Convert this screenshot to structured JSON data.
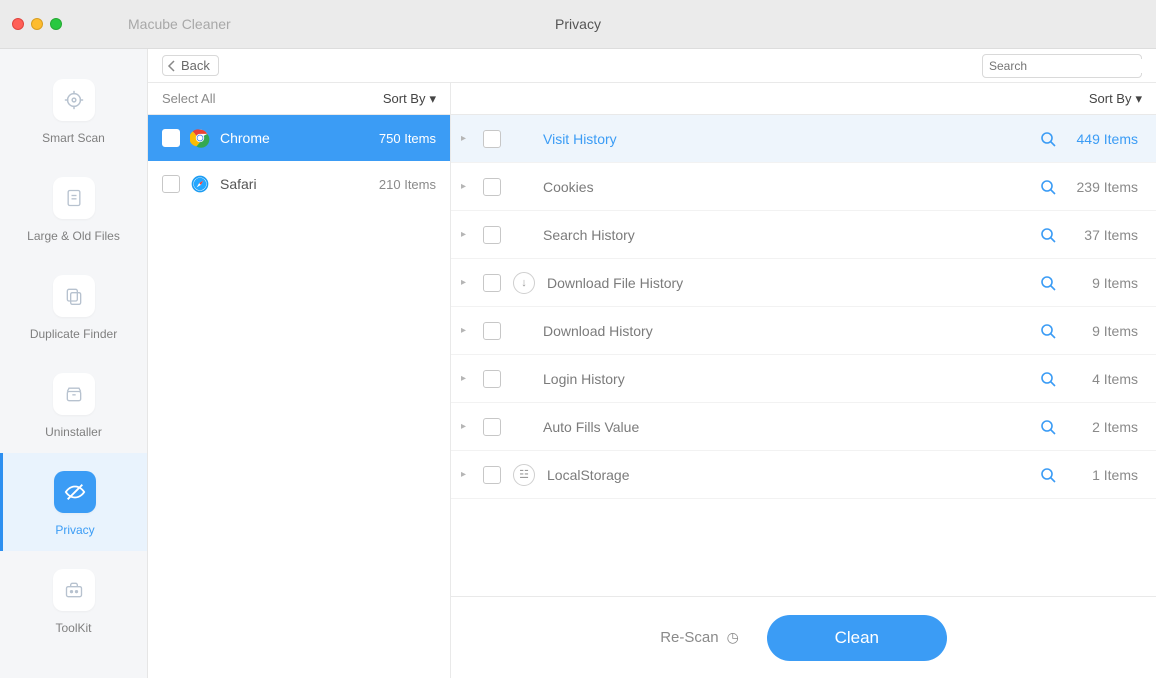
{
  "app_title": "Macube Cleaner",
  "section_title": "Privacy",
  "toolbar": {
    "back_label": "Back",
    "search_placeholder": "Search"
  },
  "sidebar": {
    "items": [
      {
        "label": "Smart Scan",
        "icon": "target-icon",
        "active": false
      },
      {
        "label": "Large & Old Files",
        "icon": "file-icon",
        "active": false
      },
      {
        "label": "Duplicate Finder",
        "icon": "copy-icon",
        "active": false
      },
      {
        "label": "Uninstaller",
        "icon": "archive-icon",
        "active": false
      },
      {
        "label": "Privacy",
        "icon": "eye-off-icon",
        "active": true
      },
      {
        "label": "ToolKit",
        "icon": "toolbox-icon",
        "active": false
      }
    ]
  },
  "left_panel": {
    "select_all_label": "Select All",
    "sort_by_label": "Sort By",
    "browsers": [
      {
        "name": "Chrome",
        "count": "750 Items",
        "selected": true,
        "icon": "chrome-icon"
      },
      {
        "name": "Safari",
        "count": "210 Items",
        "selected": false,
        "icon": "safari-icon"
      }
    ]
  },
  "right_panel": {
    "sort_by_label": "Sort By",
    "details": [
      {
        "label": "Visit History",
        "count": "449 Items",
        "highlight": true
      },
      {
        "label": "Cookies",
        "count": "239 Items"
      },
      {
        "label": "Search History",
        "count": "37 Items"
      },
      {
        "label": "Download File History",
        "count": "9 Items",
        "extra_icon": "download-icon"
      },
      {
        "label": "Download History",
        "count": "9 Items"
      },
      {
        "label": "Login History",
        "count": "4 Items"
      },
      {
        "label": "Auto Fills Value",
        "count": "2 Items"
      },
      {
        "label": "LocalStorage",
        "count": "1 Items",
        "extra_icon": "storage-icon"
      }
    ]
  },
  "footer": {
    "rescan_label": "Re-Scan",
    "clean_label": "Clean"
  },
  "icons": {
    "chevron_left": "<",
    "chevron_down": "▾",
    "triangle_right": "▸",
    "download": "↓",
    "storage": "☳",
    "rescan_clock": "◷"
  }
}
